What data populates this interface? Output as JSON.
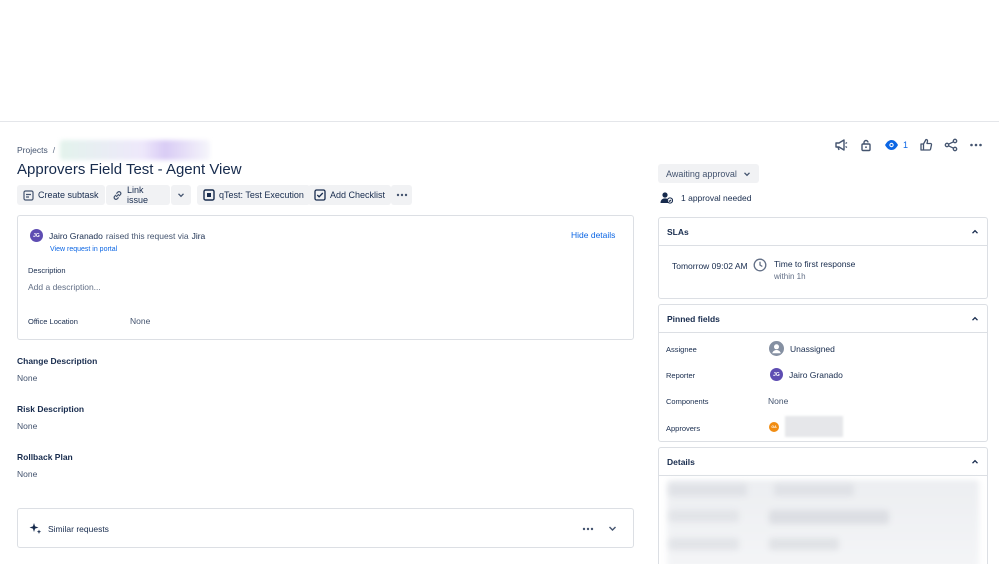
{
  "breadcrumb": {
    "projects": "Projects",
    "separator": "/"
  },
  "issue": {
    "title": "Approvers Field Test - Agent View"
  },
  "toolbar": {
    "create_subtask": "Create subtask",
    "link_issue": "Link issue",
    "qtest": "qTest: Test Execution",
    "add_checklist": "Add Checklist"
  },
  "request": {
    "avatar_initials": "JG",
    "reporter": "Jairo Granado",
    "raised_text": "raised this request via",
    "channel": "Jira",
    "view_portal": "View request in portal",
    "hide_details": "Hide details",
    "description_label": "Description",
    "description_placeholder": "Add a description...",
    "office_label": "Office Location",
    "office_value": "None"
  },
  "sections": [
    {
      "title": "Change Description",
      "value": "None"
    },
    {
      "title": "Risk Description",
      "value": "None"
    },
    {
      "title": "Rollback Plan",
      "value": "None"
    }
  ],
  "similar": {
    "label": "Similar requests"
  },
  "header_actions": {
    "watch_count": "1"
  },
  "status": {
    "label": "Awaiting approval",
    "approval_needed": "1 approval needed"
  },
  "slas": {
    "title": "SLAs",
    "time": "Tomorrow 09:02 AM",
    "goal": "Time to first response",
    "within": "within 1h"
  },
  "pinned": {
    "title": "Pinned fields",
    "assignee_label": "Assignee",
    "assignee_value": "Unassigned",
    "reporter_label": "Reporter",
    "reporter_initials": "JG",
    "reporter_value": "Jairo Granado",
    "components_label": "Components",
    "components_value": "None",
    "approvers_label": "Approvers",
    "approver_initials": "GA"
  },
  "details": {
    "title": "Details"
  },
  "colors": {
    "accent": "#0c66e4",
    "avatar": "#5e4db2",
    "approver_avatar": "#f18d13"
  }
}
